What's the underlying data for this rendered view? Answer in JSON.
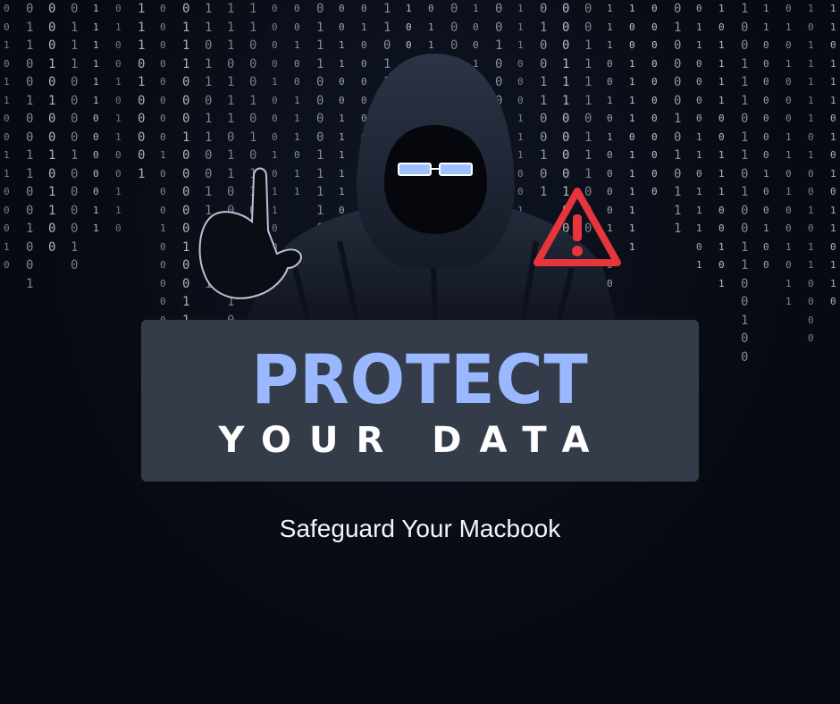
{
  "banner": {
    "title": "PROTECT",
    "subtitle": "YOUR DATA"
  },
  "tagline": "Safeguard Your Macbook",
  "icons": {
    "warning": "warning-triangle-icon",
    "figure": "hooded-hacker-figure",
    "background": "binary-code-rain"
  },
  "colors": {
    "background": "#070b13",
    "banner": "#343c4a",
    "title": "#9ab8ff",
    "warning": "#e8353b"
  }
}
